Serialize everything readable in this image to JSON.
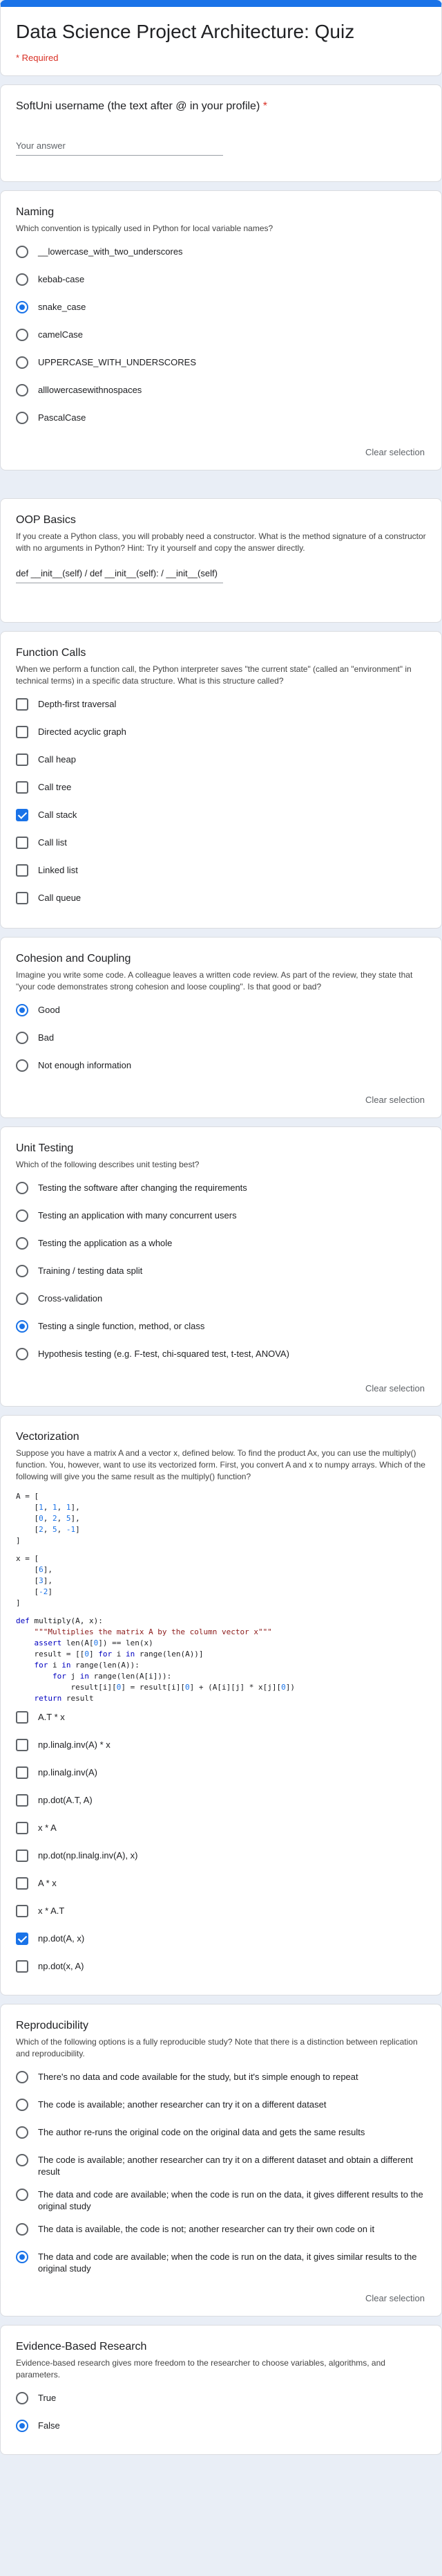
{
  "header": {
    "title": "Data Science Project Architecture: Quiz",
    "required_note": "* Required"
  },
  "username": {
    "title": "SoftUni username (the text after @ in your profile)",
    "star": "*",
    "placeholder": "Your answer"
  },
  "naming": {
    "title": "Naming",
    "desc": "Which convention is typically used in Python for local variable names?",
    "options": [
      "__lowercase_with_two_underscores",
      "kebab-case",
      "snake_case",
      "camelCase",
      "UPPERCASE_WITH_UNDERSCORES",
      "alllowercasewithnospaces",
      "PascalCase"
    ],
    "selected": 2,
    "clear": "Clear selection"
  },
  "oop": {
    "title": "OOP Basics",
    "desc": "If you create a Python class, you will probably need a constructor. What is the method signature of a constructor with no arguments in Python? Hint: Try it yourself and copy the answer directly.",
    "answer": "def __init__(self) / def __init__(self): / __init__(self)"
  },
  "function_calls": {
    "title": "Function Calls",
    "desc": "When we perform a function call, the Python interpreter saves \"the current state\" (called an \"environment\" in technical terms) in a specific data structure. What is this structure called?",
    "options": [
      "Depth-first traversal",
      "Directed acyclic graph",
      "Call heap",
      "Call tree",
      "Call stack",
      "Call list",
      "Linked list",
      "Call queue"
    ],
    "checked": [
      4
    ]
  },
  "cohesion": {
    "title": "Cohesion and Coupling",
    "desc": "Imagine you write some code. A colleague leaves a written code review. As part of the review, they state that \"your code demonstrates strong cohesion and loose coupling\". Is that good or bad?",
    "options": [
      "Good",
      "Bad",
      "Not enough information"
    ],
    "selected": 0,
    "clear": "Clear selection"
  },
  "unit_testing": {
    "title": "Unit Testing",
    "desc": "Which of the following describes unit testing best?",
    "options": [
      "Testing the software after changing the requirements",
      "Testing an application with many concurrent users",
      "Testing the application as a whole",
      "Training / testing data split",
      "Cross-validation",
      "Testing a single function, method, or class",
      "Hypothesis testing (e.g. F-test, chi-squared test, t-test, ANOVA)"
    ],
    "selected": 5,
    "clear": "Clear selection"
  },
  "vectorization": {
    "title": "Vectorization",
    "desc": "Suppose you have a matrix A and a vector x, defined below. To find the product Ax, you can use the multiply() function. You, however, want to use its vectorized form. First, you convert A and x to numpy arrays. Which of the following will give you the same result as the multiply() function?",
    "options": [
      "A.T * x",
      "np.linalg.inv(A) * x",
      "np.linalg.inv(A)",
      "np.dot(A.T, A)",
      "x * A",
      "np.dot(np.linalg.inv(A), x)",
      "A * x",
      "x * A.T",
      "np.dot(A, x)",
      "np.dot(x, A)"
    ],
    "checked": [
      8
    ]
  },
  "reproducibility": {
    "title": "Reproducibility",
    "desc": "Which of the following options is a fully reproducible study? Note that there is a distinction between replication and reproducibility.",
    "options": [
      "There's no data and code available for the study, but it's simple enough to repeat",
      "The code is available; another researcher can try it on a different dataset",
      "The author re-runs the original code on the original data and gets the same results",
      "The code is available; another researcher can try it on a different dataset and obtain a different result",
      "The data and code are available; when the code is run on the data, it gives different results to the original study",
      "The data is available, the code is not; another researcher can try their own code on it",
      "The data and code are available; when the code is run on the data, it gives similar results to the original study"
    ],
    "selected": 6,
    "clear": "Clear selection"
  },
  "evidence": {
    "title": "Evidence-Based Research",
    "desc": "Evidence-based research gives more freedom to the researcher to choose variables, algorithms, and parameters.",
    "options": [
      "True",
      "False"
    ],
    "selected": 1
  }
}
